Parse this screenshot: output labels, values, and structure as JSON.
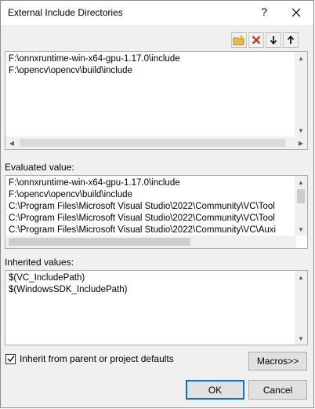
{
  "dialog": {
    "title": "External Include Directories",
    "help_glyph": "?",
    "close_glyph": "✕"
  },
  "toolbar": {
    "icons": [
      "new-folder-icon",
      "delete-icon",
      "move-down-icon",
      "move-up-icon"
    ],
    "colors": {
      "delete": "#c42b1c",
      "folder": "#e8b84a"
    }
  },
  "edit_list": {
    "lines": [
      "F:\\onnxruntime-win-x64-gpu-1.17.0\\include",
      "F:\\opencv\\opencv\\build\\include"
    ]
  },
  "evaluated": {
    "label": "Evaluated value:",
    "lines": [
      "F:\\onnxruntime-win-x64-gpu-1.17.0\\include",
      "F:\\opencv\\opencv\\build\\include",
      "C:\\Program Files\\Microsoft Visual Studio\\2022\\Community\\VC\\Tool",
      "C:\\Program Files\\Microsoft Visual Studio\\2022\\Community\\VC\\Tool",
      "C:\\Program Files\\Microsoft Visual Studio\\2022\\Community\\VC\\Auxi"
    ]
  },
  "inherited": {
    "label": "Inherited values:",
    "lines": [
      "$(VC_IncludePath)",
      "$(WindowsSDK_IncludePath)"
    ]
  },
  "inherit_checkbox": {
    "label": "Inherit from parent or project defaults",
    "checked": true
  },
  "buttons": {
    "macros": "Macros>>",
    "ok": "OK",
    "cancel": "Cancel"
  },
  "colors": {
    "accent": "#0078d7"
  }
}
